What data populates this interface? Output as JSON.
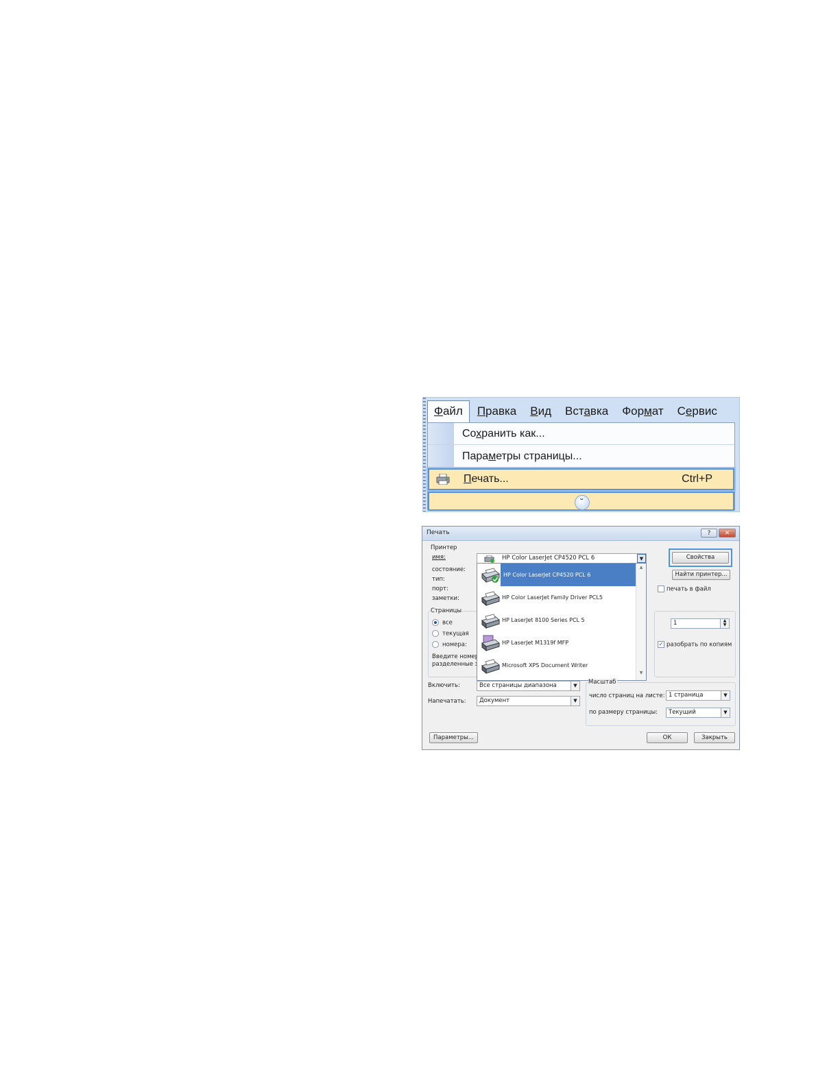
{
  "menu": {
    "bar": [
      {
        "label": "Файл",
        "key": "Ф",
        "rest": "айл",
        "open": true
      },
      {
        "label": "Правка",
        "key": "П",
        "rest": "равка"
      },
      {
        "label": "Вид",
        "key": "В",
        "rest": "ид"
      },
      {
        "label": "Вставка",
        "pre": "Вст",
        "key": "а",
        "rest": "вка"
      },
      {
        "label": "Формат",
        "pre": "Фор",
        "key": "м",
        "rest": "ат"
      },
      {
        "label": "Сервис",
        "pre": "С",
        "key": "е",
        "rest": "рвис"
      }
    ],
    "items": {
      "save_as": "Сохранить как...",
      "page_setup": "Параметры страницы...",
      "print": "Печать...",
      "print_shortcut": "Ctrl+P",
      "expand_glyph": "»"
    },
    "colors": {
      "highlight": "#fde9b3",
      "focus_border": "#5a92d4"
    }
  },
  "dialog": {
    "title": "Печать",
    "help_glyph": "?",
    "close_glyph": "✕",
    "printer_group": "Принтер",
    "name_label": "имя:",
    "status_label": "состояние:",
    "type_label": "тип:",
    "port_label": "порт:",
    "notes_label": "заметки:",
    "printer_selected": "HP Color LaserJet CP4520 PCL 6",
    "properties_button": "Свойства",
    "find_printer_button": "Найти принтер...",
    "print_to_file": "печать в файл",
    "print_to_file_checked": false,
    "printers": [
      {
        "name": "HP Color LaserJet CP4520 PCL 6",
        "selected": true,
        "icon": "printer-default-icon"
      },
      {
        "name": "HP Color LaserJet Family Driver PCL5",
        "icon": "printer-icon"
      },
      {
        "name": "HP LaserJet 8100 Series PCL 5",
        "icon": "printer-icon"
      },
      {
        "name": "HP LaserJet M1319f MFP",
        "icon": "fax-printer-icon"
      },
      {
        "name": "Microsoft XPS Document Writer",
        "icon": "printer-icon"
      }
    ],
    "pages_group": "Страницы",
    "pages_all": "все",
    "pages_current": "текущая",
    "pages_numbers": "номера:",
    "pages_hint_1": "Введите номер",
    "pages_hint_2": "разделенные з",
    "copies_value": "1",
    "collate_label": "разобрать по копиям",
    "collate_checked": true,
    "include_label": "Включить:",
    "include_value": "Все страницы диапазона",
    "print_what_label": "Напечатать:",
    "print_what_value": "Документ",
    "scale_group": "Масштаб",
    "pages_per_sheet_label": "число страниц на листе:",
    "pages_per_sheet_value": "1 страница",
    "scale_to_paper_label": "по размеру страницы:",
    "scale_to_paper_value": "Текущий",
    "options_button": "Параметры...",
    "ok_button": "ОК",
    "close_button": "Закрыть",
    "colors": {
      "selection": "#4a7fc5",
      "callout": "#4b95d8"
    }
  }
}
